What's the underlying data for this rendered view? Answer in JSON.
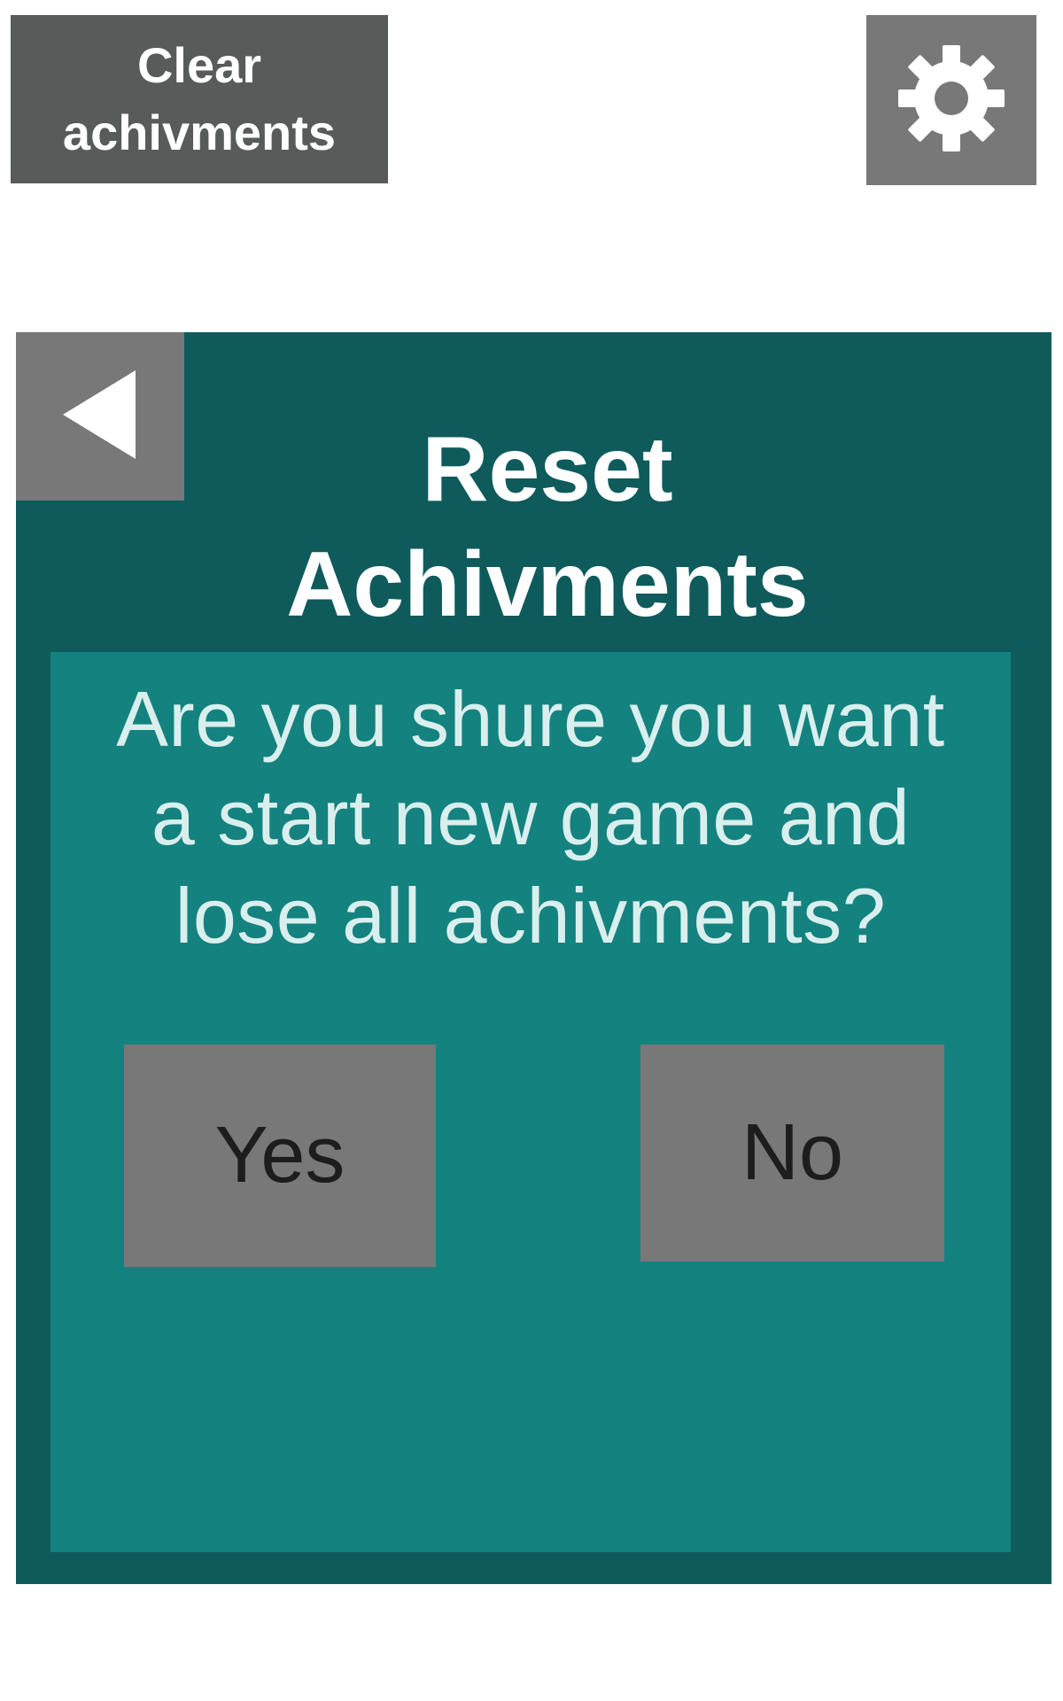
{
  "header": {
    "clear_button": {
      "line1": "Clear",
      "line2": "achivments"
    },
    "settings_icon": "gear-icon"
  },
  "dialog": {
    "back_icon": "triangle-left-icon",
    "title_line1": "Reset",
    "title_line2": "Achivments",
    "message_line1": "Are you shure you want",
    "message_line2": "a start new game and",
    "message_line3": "lose all achivments?",
    "yes_label": "Yes",
    "no_label": "No"
  },
  "colors": {
    "page_background": "#ffffff",
    "dialog_frame": "#0f5b5c",
    "dialog_body": "#14827f",
    "button_gray": "#787878",
    "clear_button_gray": "#595b5b",
    "title_text": "#ffffff",
    "message_text": "#d9efee",
    "button_text": "#1d1d1d"
  }
}
